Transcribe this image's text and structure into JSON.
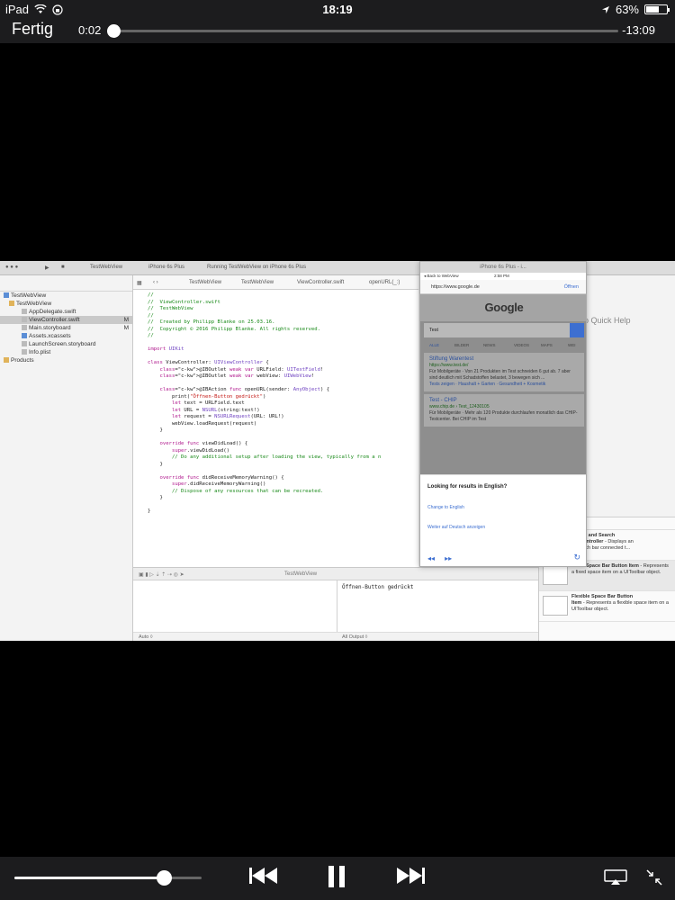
{
  "status_bar": {
    "device": "iPad",
    "time": "18:19",
    "battery": "63%",
    "battery_level": 0.63
  },
  "player": {
    "done_label": "Fertig",
    "elapsed": "0:02",
    "remaining": "-13:09",
    "progress": 0.003,
    "volume": 0.8
  },
  "xcode": {
    "toolbar": {
      "scheme": "TestWebView",
      "device": "iPhone 6s Plus",
      "status": "Running TestWebView on iPhone 6s Plus"
    },
    "navigator": {
      "items": [
        {
          "label": "TestWebView",
          "mark": ""
        },
        {
          "label": "TestWebView",
          "mark": ""
        },
        {
          "label": "AppDelegate.swift",
          "mark": ""
        },
        {
          "label": "ViewController.swift",
          "mark": "M"
        },
        {
          "label": "Main.storyboard",
          "mark": "M"
        },
        {
          "label": "Assets.xcassets",
          "mark": ""
        },
        {
          "label": "LaunchScreen.storyboard",
          "mark": ""
        },
        {
          "label": "Info.plist",
          "mark": ""
        },
        {
          "label": "Products",
          "mark": ""
        }
      ]
    },
    "jumpbar": {
      "project": "TestWebView",
      "group": "TestWebView",
      "file": "ViewController.swift",
      "symbol": "openURL(_:)"
    },
    "code_lines": [
      "//",
      "//  ViewController.swift",
      "//  TestWebView",
      "//",
      "//  Created by Philipp Blanke on 25.03.16.",
      "//  Copyright © 2016 Philipp Blanke. All rights reserved.",
      "//",
      "",
      "import UIKit",
      "",
      "class ViewController: UIViewController {",
      "    @IBOutlet weak var URLField: UITextField!",
      "    @IBOutlet weak var webView: UIWebView!",
      "",
      "    @IBAction func openURL(sender: AnyObject) {",
      "        print(\"Öffnen-Button gedrückt\")",
      "        let text = URLField.text",
      "        let URL = NSURL(string:text!)",
      "        let request = NSURLRequest(URL: URL!)",
      "        webView.loadRequest(request)",
      "    }",
      "",
      "    override func viewDidLoad() {",
      "        super.viewDidLoad()",
      "        // Do any additional setup after loading the view, typically from a n",
      "    }",
      "",
      "    override func didReceiveMemoryWarning() {",
      "        super.didReceiveMemoryWarning()",
      "        // Dispose of any resources that can be recreated.",
      "    }",
      "",
      "}"
    ],
    "debug": {
      "target": "TestWebView",
      "console_output": "Öffnen-Button gedrückt",
      "auto_label": "Auto ◊",
      "output_label": "All Output ◊"
    },
    "utilities": {
      "quick_help": "o Quick Help",
      "library": [
        {
          "title": "ch Bar and Search",
          "title2": "lay Controller",
          "desc": " - Displays an",
          "desc2": "e search bar connected t..."
        },
        {
          "title": "Fixed Space Bar Button Item",
          "title2": "",
          "desc": " - Represents a fixed space item on a UIToolbar object.",
          "desc2": ""
        },
        {
          "title": "Flexible Space Bar Button",
          "title2": "Item",
          "desc": " - Represents a flexible space item on a UIToolbar object.",
          "desc2": ""
        }
      ]
    },
    "simulator": {
      "title": "iPhone 6s Plus - i...",
      "back": "◂ Back to WebView",
      "clock": "2:58 PM",
      "url": "https://www.google.de",
      "open_button": "Öffnen",
      "logo": "Google",
      "query": "Test",
      "tabs": [
        "ALLE",
        "BILDER",
        "NEWS",
        "VIDEOS",
        "MAPS",
        "WEI"
      ],
      "results": [
        {
          "title": "Stiftung Warentest",
          "url": "https://www.test.de/",
          "snippet": "Für Mobilgeräte · Von 21 Produkten im Test schneiden 6 gut ab. 7 aber sind deutlich mit Schadstoffen belastet, 3 bewegen sich ...",
          "links": "Tests zeigen · Haushalt + Garten · Gesundheit + Kosmetik"
        },
        {
          "title": "Test - CHIP",
          "url": "www.chip.de › Test_12430105",
          "snippet": "Für Mobilgeräte · Mehr als 120 Produkte durchlaufen monatlich das CHIP-Testcenter. Bei CHIP im Test",
          "links": ""
        }
      ],
      "sheet": {
        "question": "Looking for results in English?",
        "option1": "Change to English",
        "option2": "Weiter auf Deutsch anzeigen"
      }
    }
  }
}
